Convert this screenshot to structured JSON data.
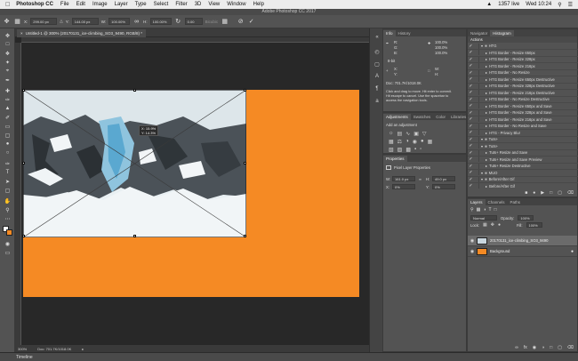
{
  "menubar": {
    "app_name": "Photoshop CC",
    "items": [
      "File",
      "Edit",
      "Image",
      "Layer",
      "Type",
      "Select",
      "Filter",
      "3D",
      "View",
      "Window",
      "Help"
    ],
    "battery": "1357 live",
    "clock": "Wed 10:24"
  },
  "window_title": "Adobe Photoshop CC 2017",
  "options": {
    "x_label": "X:",
    "x_value": "299.00 px",
    "y_label": "Y:",
    "y_value": "144.00 px",
    "w_label": "W:",
    "w_value": "100.00%",
    "h_label": "H:",
    "h_value": "100.00%",
    "angle_value": "0.00",
    "interp_label": "Bicubic",
    "cancel_icon": "cancel-icon",
    "commit_icon": "commit-icon"
  },
  "document": {
    "tab_title": "Untitled-1 @ 300% (20170131_ice-climbing_SO3_9490, RGB/8) *",
    "tooltip_line1": "X: 15.9%",
    "tooltip_line2": "Y: 14.3%"
  },
  "status": {
    "zoom": "300%",
    "doc_size": "Doc: 701.7K/1018.0K"
  },
  "timeline_label": "Timeline",
  "info_panel": {
    "tabs": [
      "Info",
      "History"
    ],
    "r_label": "R:",
    "g_label": "G:",
    "b_label": "B:",
    "bit_label": "8-bit",
    "x_label": "X:",
    "y_label": "Y:",
    "w_label": "W:",
    "h_label": "H:",
    "pct": [
      "100.0%",
      "100.0%",
      "100.0%"
    ],
    "doc": "Doc: 701.7K/1018.0K",
    "help_text": [
      "Click and drag to move. Hit enter to commit.",
      "Hit escape to cancel. Use the spacebar to",
      "access the navigation tools."
    ]
  },
  "adjustments_panel": {
    "tabs": [
      "Adjustments",
      "Swatches",
      "Color",
      "Libraries"
    ],
    "header": "Add an adjustment"
  },
  "properties_panel": {
    "tab": "Properties",
    "title": "Pixel Layer Properties",
    "w_label": "W:",
    "w_value": "161.0 px",
    "h_label": "H:",
    "h_value": "49.0 px",
    "x_label": "X:",
    "x_value": "0%",
    "y_label": "Y:",
    "y_value": "0%"
  },
  "actions_panel": {
    "tabs": [
      "Navigator",
      "Histogram"
    ],
    "header": "Actions",
    "items": [
      {
        "label": "HTG",
        "level": 0,
        "folder": true
      },
      {
        "label": "HTG Border - Resize 650px",
        "level": 1
      },
      {
        "label": "HTG Border - Resize 328px",
        "level": 1
      },
      {
        "label": "HTG Border - Resize 216px",
        "level": 1
      },
      {
        "label": "HTG Border - No Resize",
        "level": 1
      },
      {
        "label": "HTG Border - Resize 650px Destructive",
        "level": 1
      },
      {
        "label": "HTG Border - Resize 328px Destructive",
        "level": 1
      },
      {
        "label": "HTG Border - Resize 216px Destructive",
        "level": 1
      },
      {
        "label": "HTG Border - No Resize Destructive",
        "level": 1
      },
      {
        "label": "HTG Border - Resize 650px and Save",
        "level": 1
      },
      {
        "label": "HTG Border - Resize 328px and Save",
        "level": 1
      },
      {
        "label": "HTG Border - Resize 216px and Save",
        "level": 1
      },
      {
        "label": "HTG Border - No Resize and Save",
        "level": 1
      },
      {
        "label": "HTG - Privacy Blur",
        "level": 1
      },
      {
        "label": "Tuts+",
        "level": 0,
        "folder": true
      },
      {
        "label": "Tuts+",
        "level": 0,
        "folder": true
      },
      {
        "label": "Tuts+ Resize and Save",
        "level": 1
      },
      {
        "label": "Tuts+ Resize and Save Preview",
        "level": 1
      },
      {
        "label": "Tuts+ Resize Destructive",
        "level": 1
      },
      {
        "label": "MUO",
        "level": 0,
        "folder": true
      },
      {
        "label": "Before/After Gif",
        "level": 0,
        "folder": true
      },
      {
        "label": "Before/After Gif",
        "level": 1
      }
    ]
  },
  "layers_panel": {
    "tabs": [
      "Layers",
      "Channels",
      "Paths"
    ],
    "blend_mode": "Normal",
    "opacity_label": "Opacity:",
    "opacity_value": "100%",
    "lock_label": "Lock:",
    "fill_label": "Fill:",
    "fill_value": "100%",
    "layers": [
      {
        "name": "20170131_ice-climbing_SO3_9490",
        "color": "#c9d7df"
      },
      {
        "name": "Background",
        "color": "#f58a24"
      }
    ]
  },
  "colors": {
    "document_fill": "#f58a24",
    "foreground_swatch": "#ffffff",
    "background_swatch": "#f58a24"
  }
}
